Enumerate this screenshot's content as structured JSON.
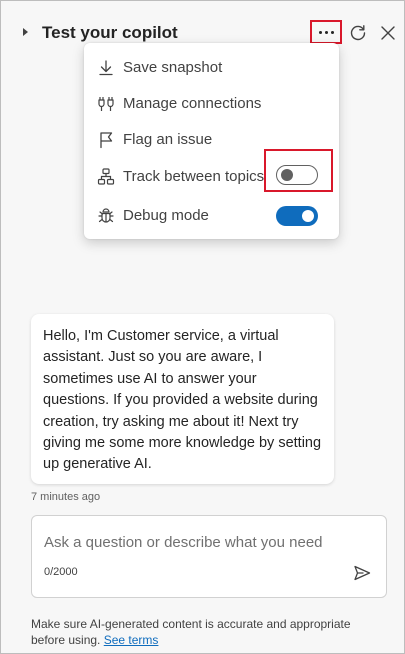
{
  "header": {
    "title": "Test your copilot"
  },
  "menu": {
    "items": [
      {
        "label": "Save snapshot",
        "icon": "download-icon"
      },
      {
        "label": "Manage connections",
        "icon": "plug-icon"
      },
      {
        "label": "Flag an issue",
        "icon": "flag-icon"
      },
      {
        "label": "Track between topics",
        "icon": "topics-icon",
        "toggle": false
      },
      {
        "label": "Debug mode",
        "icon": "bug-icon",
        "toggle": true
      }
    ]
  },
  "chat": {
    "message": "Hello, I'm Customer service, a virtual assistant. Just so you are aware, I sometimes use AI to answer your questions. If you provided a website during creation, try asking me about it! Next try giving me some more knowledge by setting up generative AI.",
    "timestamp": "7 minutes ago"
  },
  "input": {
    "placeholder": "Ask a question or describe what you need",
    "value": "",
    "counter": "0/2000"
  },
  "footer": {
    "disclaimer": "Make sure AI-generated content is accurate and appropriate before using.",
    "link_label": "See terms"
  },
  "colors": {
    "accent": "#0f6cbd",
    "highlight": "#d9182b"
  }
}
